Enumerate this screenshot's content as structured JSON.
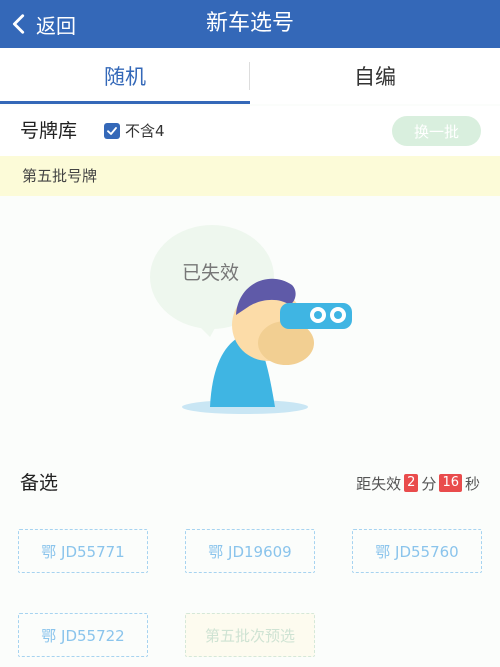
{
  "navbar": {
    "back_label": "返回",
    "title": "新车选号"
  },
  "tabs": [
    {
      "label": "随机",
      "active": true
    },
    {
      "label": "自编",
      "active": false
    }
  ],
  "library": {
    "title": "号牌库",
    "checkbox_label": "不含4",
    "checkbox_checked": true,
    "swap_label": "换一批"
  },
  "batch": {
    "label": "第五批号牌"
  },
  "status": {
    "expired_text": "已失效"
  },
  "spare": {
    "title": "备选",
    "countdown_prefix": "距失效",
    "minutes": "2",
    "minutes_unit": "分",
    "seconds": "16",
    "seconds_unit": "秒"
  },
  "plates": [
    "鄂 JD55771",
    "鄂 JD19609",
    "鄂 JD55760",
    "鄂 JD55722"
  ],
  "next_batch_label": "第五批次预选",
  "colors": {
    "brand": "#3468b8",
    "accent_red": "#e94c4c",
    "plate_border": "#a6d3f0"
  }
}
